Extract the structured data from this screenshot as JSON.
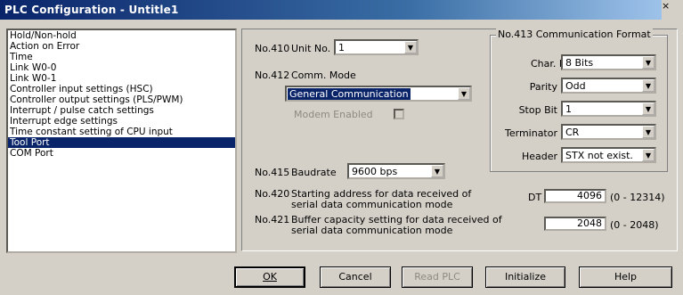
{
  "window": {
    "title": "PLC Configuration - Untitle1",
    "close_glyph": "×"
  },
  "sidebar": {
    "items": [
      {
        "label": "Hold/Non-hold"
      },
      {
        "label": "Action on Error"
      },
      {
        "label": "Time"
      },
      {
        "label": "Link W0-0"
      },
      {
        "label": "Link W0-1"
      },
      {
        "label": "Controller input settings (HSC)"
      },
      {
        "label": "Controller output settings (PLS/PWM)"
      },
      {
        "label": "Interrupt / pulse catch settings"
      },
      {
        "label": "Interrupt edge settings"
      },
      {
        "label": "Time constant setting of CPU input"
      },
      {
        "label": "Tool Port",
        "selected": true
      },
      {
        "label": "COM Port"
      }
    ]
  },
  "settings": {
    "no410": "No.410",
    "unit_label": "Unit No.",
    "unit_value": "1",
    "no412": "No.412",
    "comm_mode_label": "Comm. Mode",
    "comm_mode_value": "General Communication",
    "modem_label": "Modem Enabled",
    "no415": "No.415",
    "baudrate_label": "Baudrate",
    "baudrate_value": "9600 bps",
    "no420": "No.420",
    "start_addr_label_1": "Starting address for data received of",
    "start_addr_label_2": "serial data communication mode",
    "dt_label": "DT",
    "start_addr_value": "4096",
    "start_addr_range": "(0 - 12314)",
    "no421": "No.421",
    "buffer_label_1": "Buffer capacity setting for data received of",
    "buffer_label_2": "serial data communication mode",
    "buffer_value": "2048",
    "buffer_range": "(0 - 2048)"
  },
  "format": {
    "title": "No.413 Communication Format",
    "char_bit_label": "Char. Bit",
    "char_bit_value": "8 Bits",
    "parity_label": "Parity",
    "parity_value": "Odd",
    "stop_bit_label": "Stop Bit",
    "stop_bit_value": "1",
    "terminator_label": "Terminator",
    "terminator_value": "CR",
    "header_label": "Header",
    "header_value": "STX not exist."
  },
  "buttons": {
    "ok": "OK",
    "cancel": "Cancel",
    "read_plc": "Read PLC",
    "initialize": "Initialize",
    "help": "Help"
  }
}
